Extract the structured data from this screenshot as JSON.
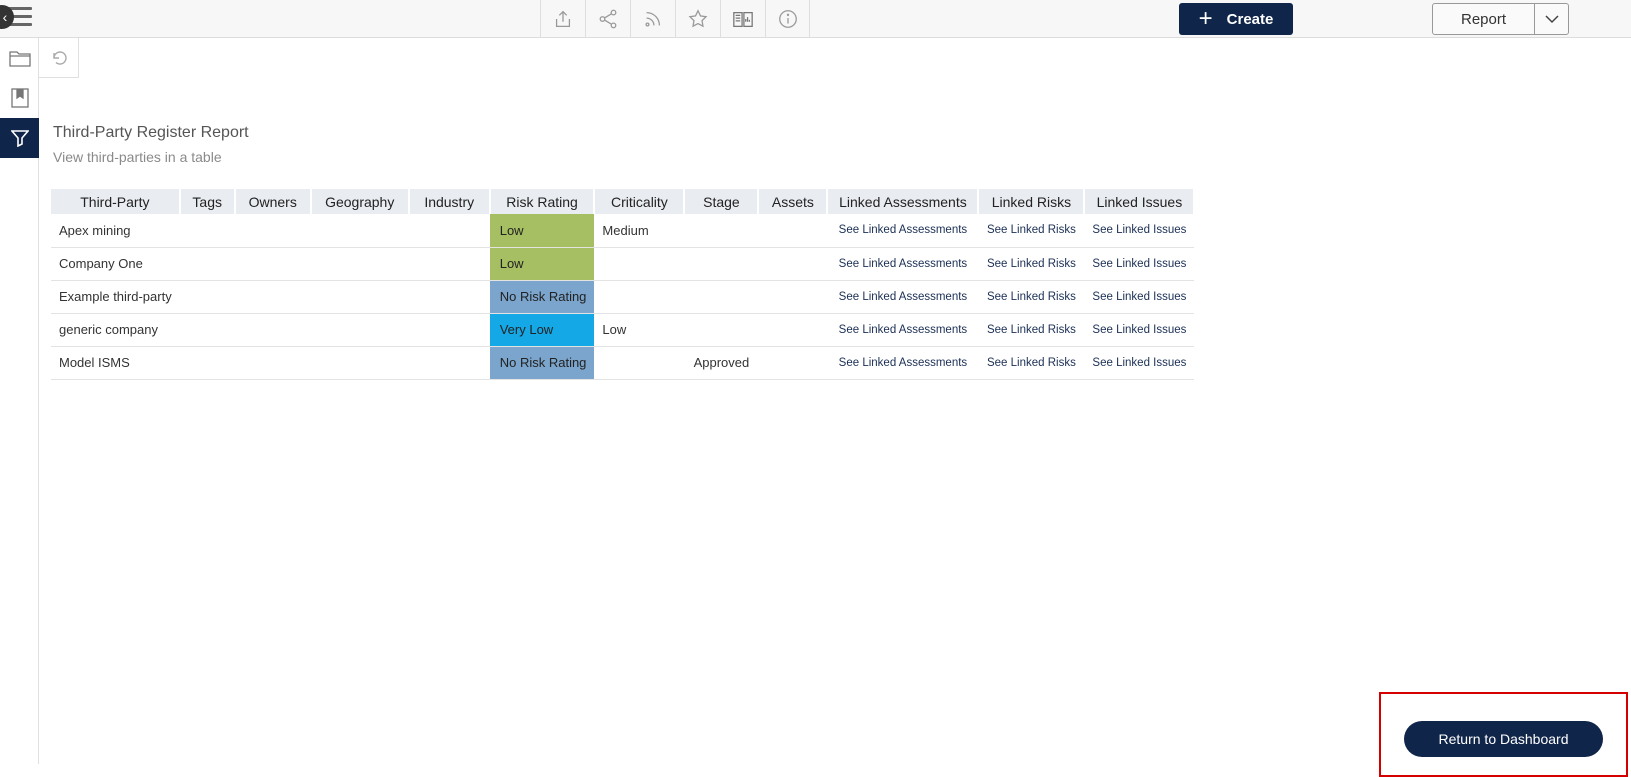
{
  "toolbar": {
    "icons": [
      "export-icon",
      "share-icon",
      "rss-icon",
      "star-icon",
      "report-book-icon",
      "info-icon"
    ],
    "create_label": "Create",
    "report_label": "Report"
  },
  "sidebar": {
    "items": [
      "folder-icon",
      "bookmark-icon",
      "filter-icon"
    ],
    "active": "filter-icon"
  },
  "report": {
    "title": "Third-Party Register Report",
    "subtitle": "View third-parties in a table"
  },
  "table": {
    "columns": [
      "Third-Party",
      "Tags",
      "Owners",
      "Geography",
      "Industry",
      "Risk Rating",
      "Criticality",
      "Stage",
      "Assets",
      "Linked Assessments",
      "Linked Risks",
      "Linked Issues"
    ],
    "rows": [
      {
        "third_party": "Apex mining",
        "risk_rating": "Low",
        "criticality": "Medium",
        "stage": "",
        "linked_assessments": "See Linked Assessments",
        "linked_risks": "See Linked Risks",
        "linked_issues": "See Linked Issues"
      },
      {
        "third_party": "Company One",
        "risk_rating": "Low",
        "criticality": "",
        "stage": "",
        "linked_assessments": "See Linked Assessments",
        "linked_risks": "See Linked Risks",
        "linked_issues": "See Linked Issues"
      },
      {
        "third_party": "Example third-party",
        "risk_rating": "No Risk Rating",
        "criticality": "",
        "stage": "",
        "linked_assessments": "See Linked Assessments",
        "linked_risks": "See Linked Risks",
        "linked_issues": "See Linked Issues"
      },
      {
        "third_party": "generic company",
        "risk_rating": "Very Low",
        "criticality": "Low",
        "stage": "",
        "linked_assessments": "See Linked Assessments",
        "linked_risks": "See Linked Risks",
        "linked_issues": "See Linked Issues"
      },
      {
        "third_party": "Model ISMS",
        "risk_rating": "No Risk Rating",
        "criticality": "",
        "stage": "Approved",
        "linked_assessments": "See Linked Assessments",
        "linked_risks": "See Linked Risks",
        "linked_issues": "See Linked Issues"
      }
    ],
    "risk_colors": {
      "Low": "#a7bf63",
      "No Risk Rating": "#7ba5cc",
      "Very Low": "#14a8e6"
    }
  },
  "footer": {
    "return_label": "Return to Dashboard"
  },
  "colors": {
    "brand_navy": "#10254a",
    "highlight_red": "#d40000"
  }
}
